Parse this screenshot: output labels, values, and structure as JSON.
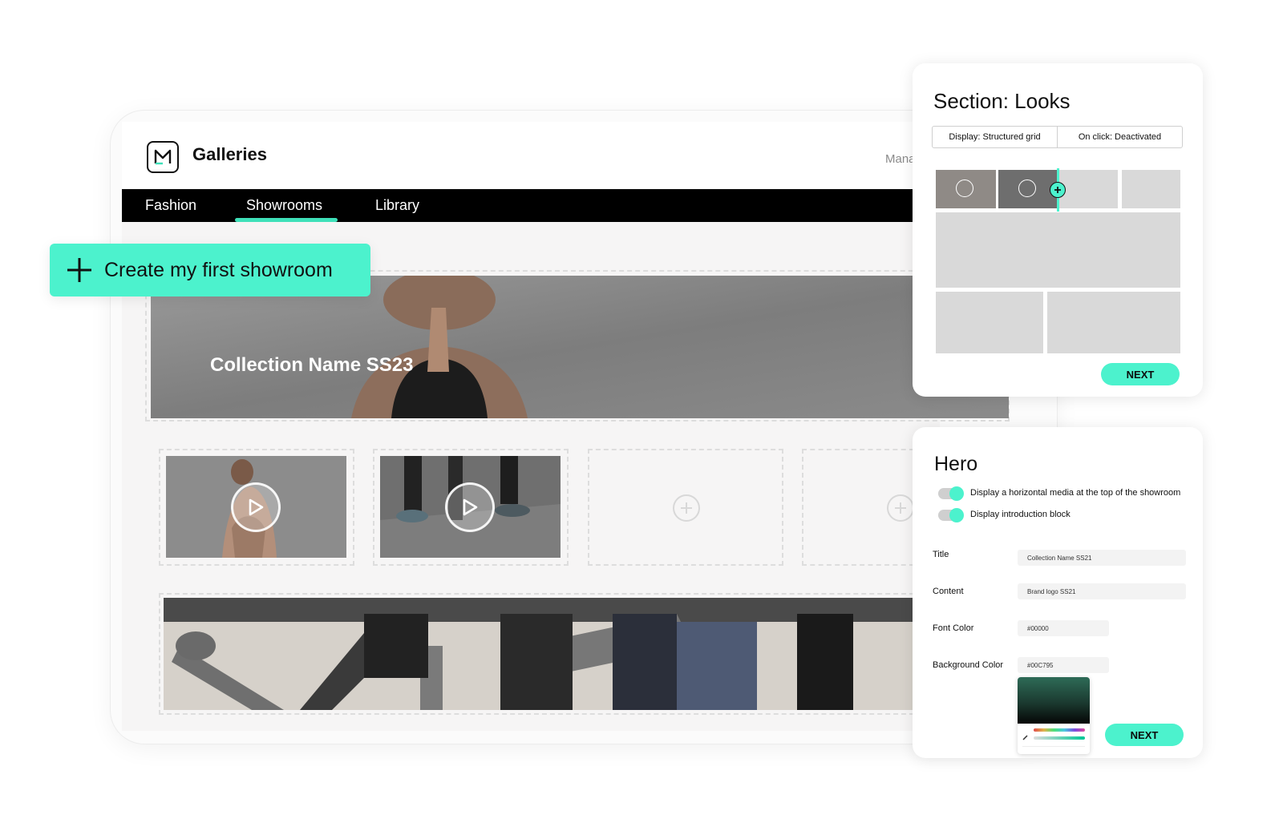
{
  "app": {
    "title": "Galleries",
    "header_right_text": "Manage y"
  },
  "nav": {
    "items": [
      {
        "label": "Fashion"
      },
      {
        "label": "Showrooms",
        "active": true
      },
      {
        "label": "Library"
      }
    ]
  },
  "create_button": {
    "label": "Create my first showroom"
  },
  "hero_banner": {
    "title": "Collection Name SS23"
  },
  "colors": {
    "accent": "#4cf2cd",
    "nav_bg": "#000000",
    "placeholder": "#d9d9d9"
  },
  "section_panel": {
    "title": "Section: Looks",
    "display_option": "Display: Structured grid",
    "onclick_option": "On click: Deactivated",
    "next_label": "NEXT"
  },
  "hero_panel": {
    "title": "Hero",
    "toggles": [
      {
        "label": "Display a horizontal media at the top of the showroom",
        "on": true
      },
      {
        "label": "Display introduction block",
        "on": true
      }
    ],
    "fields": {
      "title_label": "Title",
      "title_value": "Collection Name SS21",
      "content_label": "Content",
      "content_value": "Brand logo SS21",
      "font_color_label": "Font Color",
      "font_color_value": "#00000",
      "bg_color_label": "Background Color",
      "bg_color_value": "#00C795"
    },
    "next_label": "NEXT"
  }
}
